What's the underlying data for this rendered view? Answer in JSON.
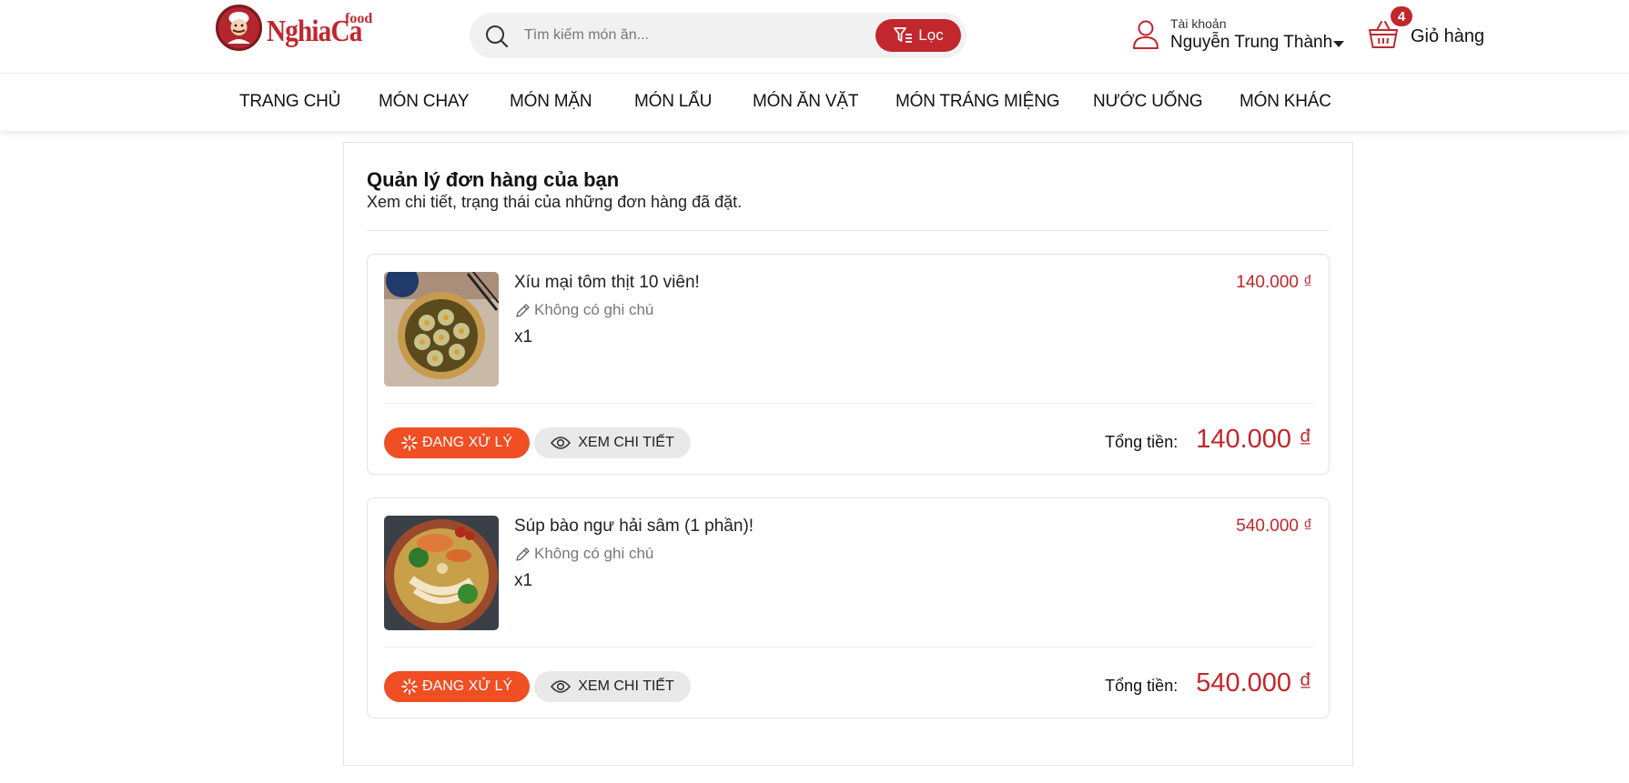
{
  "brand": {
    "name": "NghiaCa",
    "sup": "food",
    "color": "#c1272d"
  },
  "search": {
    "placeholder": "Tìm kiếm món ăn...",
    "filter_label": "Lọc"
  },
  "account": {
    "label": "Tài khoản",
    "name": "Nguyễn Trung Thành"
  },
  "cart": {
    "count": "4",
    "label": "Giỏ hàng"
  },
  "nav": {
    "items": [
      {
        "label": "TRANG CHỦ"
      },
      {
        "label": "MÓN CHAY"
      },
      {
        "label": "MÓN MẶN"
      },
      {
        "label": "MÓN LẨU"
      },
      {
        "label": "MÓN ĂN VẶT"
      },
      {
        "label": "MÓN TRÁNG MIỆNG"
      },
      {
        "label": "NƯỚC UỐNG"
      },
      {
        "label": "MÓN KHÁC"
      }
    ]
  },
  "orders_page": {
    "title": "Quản lý đơn hàng của bạn",
    "subtitle": "Xem chi tiết, trạng thái của những đơn hàng đã đặt."
  },
  "orders": [
    {
      "name": "Xíu mại tôm thịt 10 viên!",
      "note": "Không có ghi chú",
      "qty": "x1",
      "price": "140.000 ₫",
      "status": "ĐANG XỬ LÝ",
      "detail": "XEM CHI TIẾT",
      "total_label": "Tổng tiền:",
      "total": "140.000 ₫",
      "image_icon": "dumpling-dish-photo"
    },
    {
      "name": "Súp bào ngư hải sâm (1 phần)!",
      "note": "Không có ghi chú",
      "qty": "x1",
      "price": "540.000 ₫",
      "status": "ĐANG XỬ LÝ",
      "detail": "XEM CHI TIẾT",
      "total_label": "Tổng tiền:",
      "total": "540.000 ₫",
      "image_icon": "soup-bowl-photo"
    }
  ],
  "colors": {
    "accent": "#c1272d",
    "status": "#f04e23",
    "muted_button": "#e9e9e9"
  }
}
